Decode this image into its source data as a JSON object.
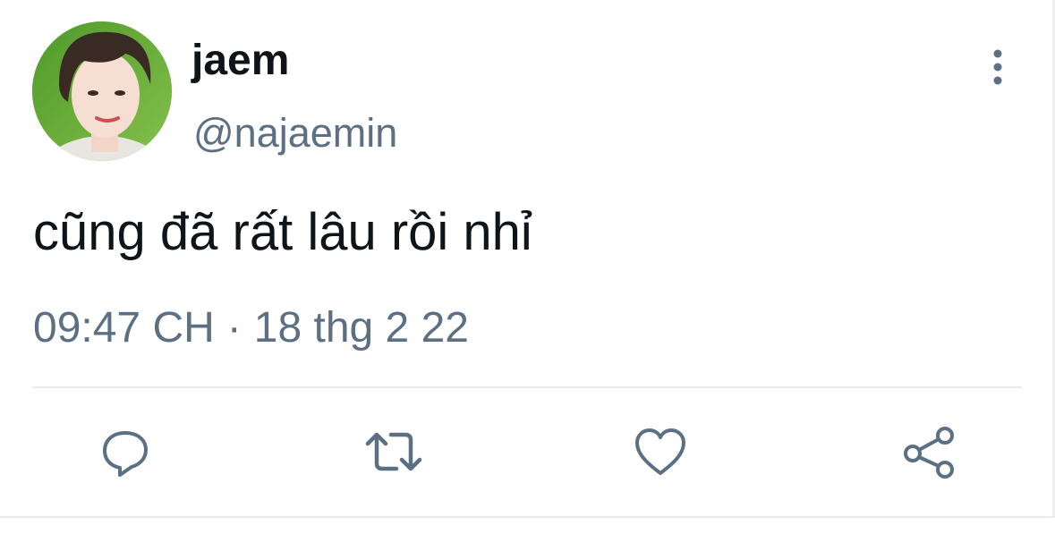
{
  "author": {
    "display_name": "jaem",
    "handle": "@najaemin"
  },
  "tweet": {
    "text": "cũng đã rất lâu rồi nhỉ",
    "time": "09:47 CH",
    "separator": "·",
    "date": "18 thg 2 22"
  },
  "icons": {
    "more": "more-vertical-icon",
    "reply": "reply-icon",
    "retweet": "retweet-icon",
    "like": "heart-icon",
    "share": "share-icon"
  },
  "colors": {
    "text_primary": "#0f1419",
    "text_secondary": "#5b7083",
    "divider": "#e6ecf0"
  }
}
